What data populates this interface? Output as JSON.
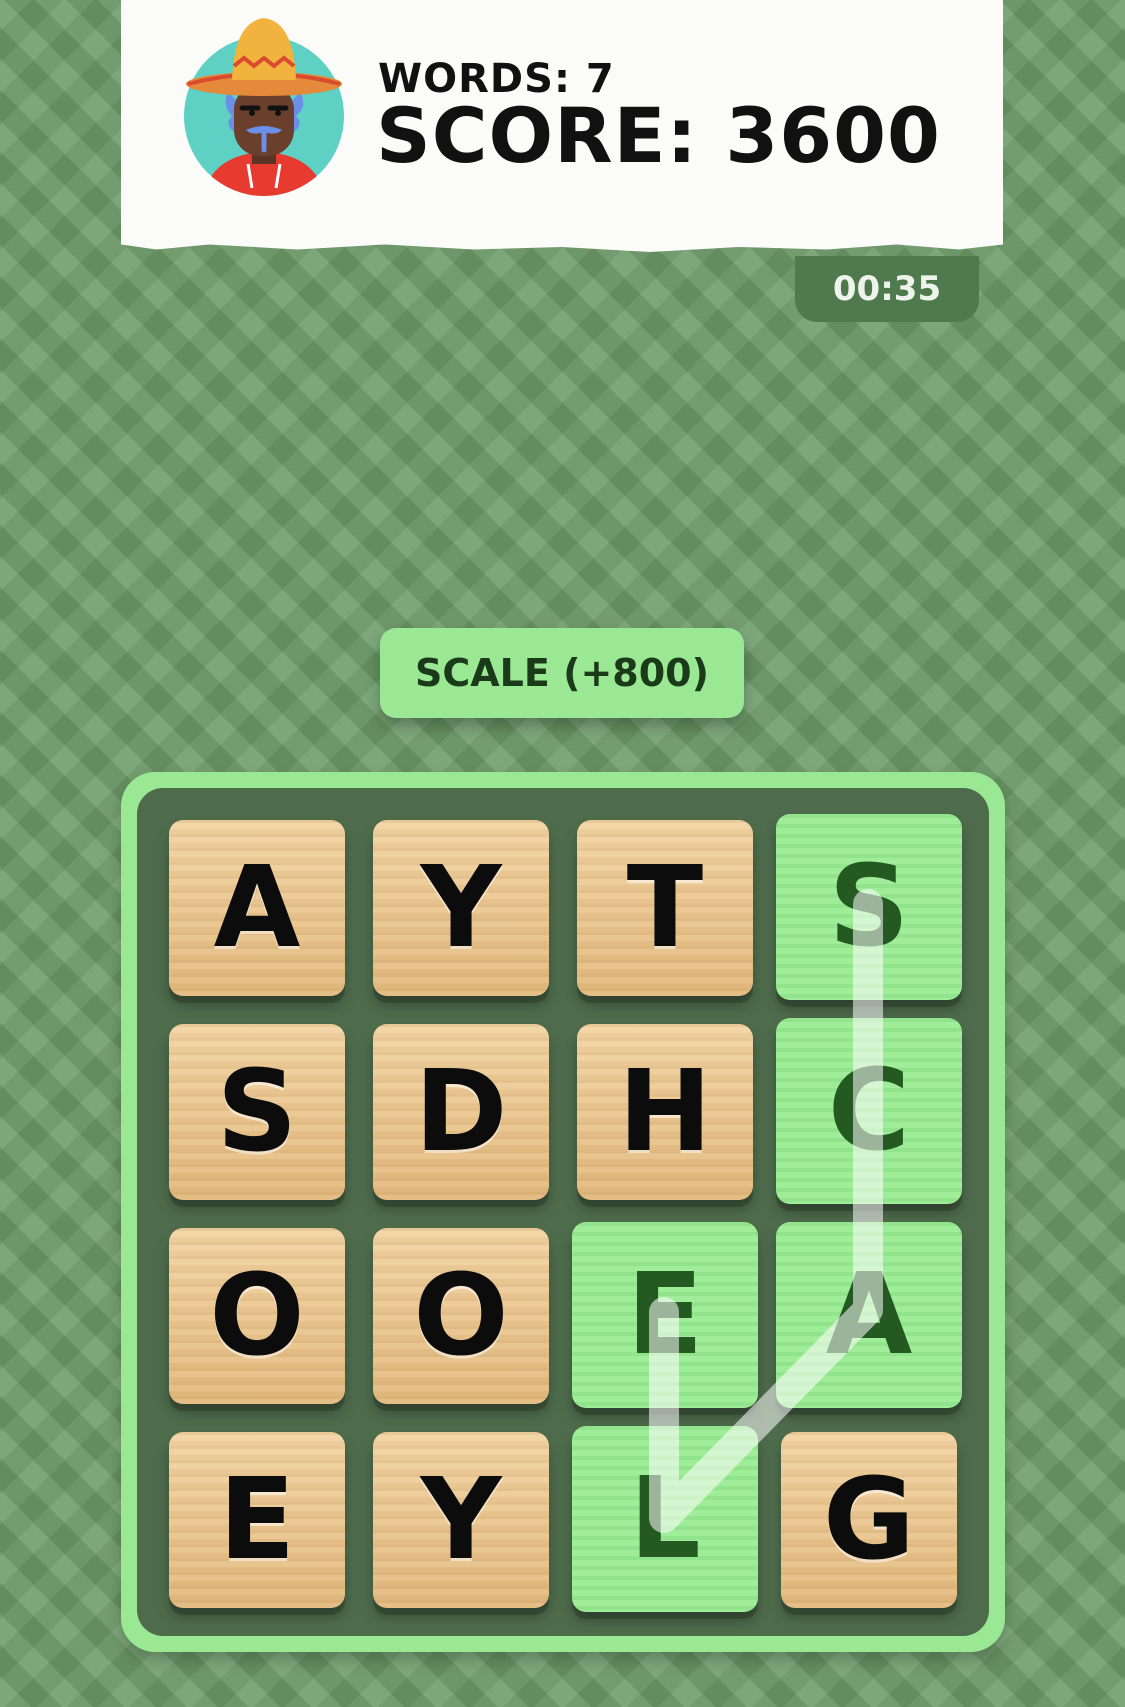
{
  "header": {
    "avatar_icon": "sombrero-character-avatar-icon",
    "words_label": "WORDS: 7",
    "score_label": "SCORE: 3600"
  },
  "timer": {
    "value": "00:35"
  },
  "current_word": {
    "label": "SCALE (+800)"
  },
  "board": {
    "rows": [
      [
        "A",
        "Y",
        "T",
        "S"
      ],
      [
        "S",
        "D",
        "H",
        "C"
      ],
      [
        "O",
        "O",
        "E",
        "A"
      ],
      [
        "E",
        "Y",
        "L",
        "G"
      ]
    ],
    "selected_path": [
      "S",
      "C",
      "A",
      "L",
      "E"
    ],
    "colors": {
      "selected_tile": "#99ec93",
      "board_frame": "#9be894",
      "board_background": "#4e6c4c",
      "tile_wood": "#e8c48c"
    }
  }
}
